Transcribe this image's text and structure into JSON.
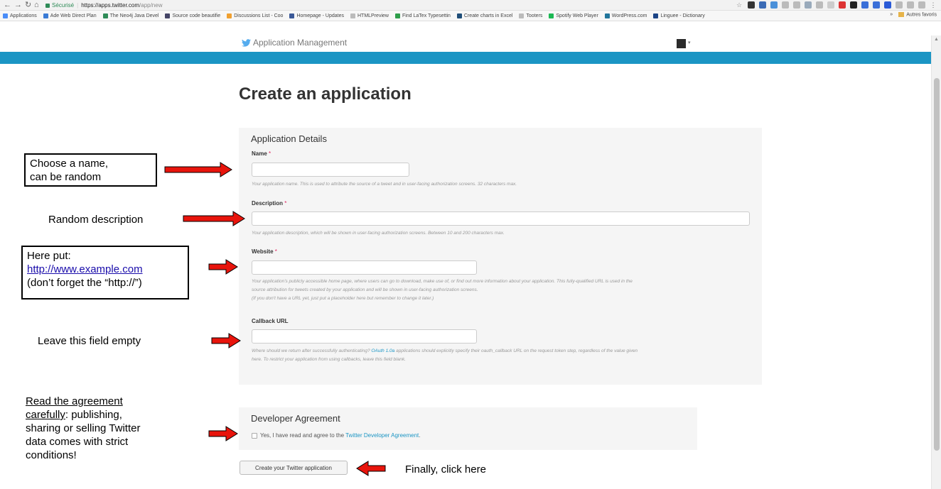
{
  "browser": {
    "secure_label": "Sécurisé",
    "url_host": "https://apps.twitter.com",
    "url_path": "/app/new",
    "bookmarks": [
      {
        "label": "Applications",
        "color": "#4a8df8"
      },
      {
        "label": "Ade Web Direct Plan",
        "color": "#3a7bd5"
      },
      {
        "label": "The Neo4j Java Devel",
        "color": "#2e8b57"
      },
      {
        "label": "Source code beautifie",
        "color": "#444466"
      },
      {
        "label": "Discussions List - Coo",
        "color": "#f0a030"
      },
      {
        "label": "Homepage - Updates",
        "color": "#3b5998"
      },
      {
        "label": "HTMLPreview",
        "color": "#bbbbbb"
      },
      {
        "label": "Find LaTex Typesettin",
        "color": "#2e9e4a"
      },
      {
        "label": "Create charts in Excel",
        "color": "#1f4e79"
      },
      {
        "label": "Tooters",
        "color": "#bbbbbb"
      },
      {
        "label": "Spotify Web Player",
        "color": "#1db954"
      },
      {
        "label": "WordPress.com",
        "color": "#21759b"
      },
      {
        "label": "Linguee - Dictionary",
        "color": "#1c4587"
      }
    ],
    "more_label": "»",
    "other_bookmarks": "Autres favoris"
  },
  "header": {
    "brand": "Application Management",
    "brand_color": "#55acee",
    "band_color": "#1b95c4"
  },
  "page": {
    "title": "Create an application"
  },
  "details": {
    "heading": "Application Details",
    "required_mark": "*",
    "name_label": "Name",
    "name_help": "Your application name. This is used to attribute the source of a tweet and in user-facing authorization screens. 32 characters max.",
    "description_label": "Description",
    "description_help": "Your application description, which will be shown in user-facing authorization screens. Between 10 and 200 characters max.",
    "website_label": "Website",
    "website_help_1": "Your application's publicly accessible home page, where users can go to download, make use of, or find out more information about your application. This fully-qualified URL is used in the",
    "website_help_2": "source attribution for tweets created by your application and will be shown in user-facing authorization screens.",
    "website_help_3": "(If you don't have a URL yet, just put a placeholder here but remember to change it later.)",
    "callback_label": "Callback URL",
    "callback_help_1a": "Where should we return after successfully authenticating?",
    "callback_help_link": "OAuth 1.0a",
    "callback_help_1b": "applications should explicitly specify their oauth_callback URL on the request token step, regardless of the value given",
    "callback_help_2": "here. To restrict your application from using callbacks, leave this field blank."
  },
  "agreement": {
    "heading": "Developer Agreement",
    "checkbox_text": "Yes, I have read and agree to the",
    "link_text": "Twitter Developer Agreement",
    "period": "."
  },
  "submit": {
    "label": "Create your Twitter application"
  },
  "annotations": {
    "name_1": "Choose a name,",
    "name_2": "can be random",
    "description": "Random description",
    "website_1": "Here put:",
    "website_link": "http://www.example.com",
    "website_3": "(don’t forget the “http://”)",
    "callback": "Leave this field empty",
    "agree_underlined_1": "Read the agreement",
    "agree_underlined_2": "carefully",
    "agree_rest_2": ": publishing,",
    "agree_3": "sharing or selling Twitter",
    "agree_4": "data comes with strict",
    "agree_5": "conditions!",
    "click": "Finally, click here",
    "arrow_color": "#e8140c"
  }
}
